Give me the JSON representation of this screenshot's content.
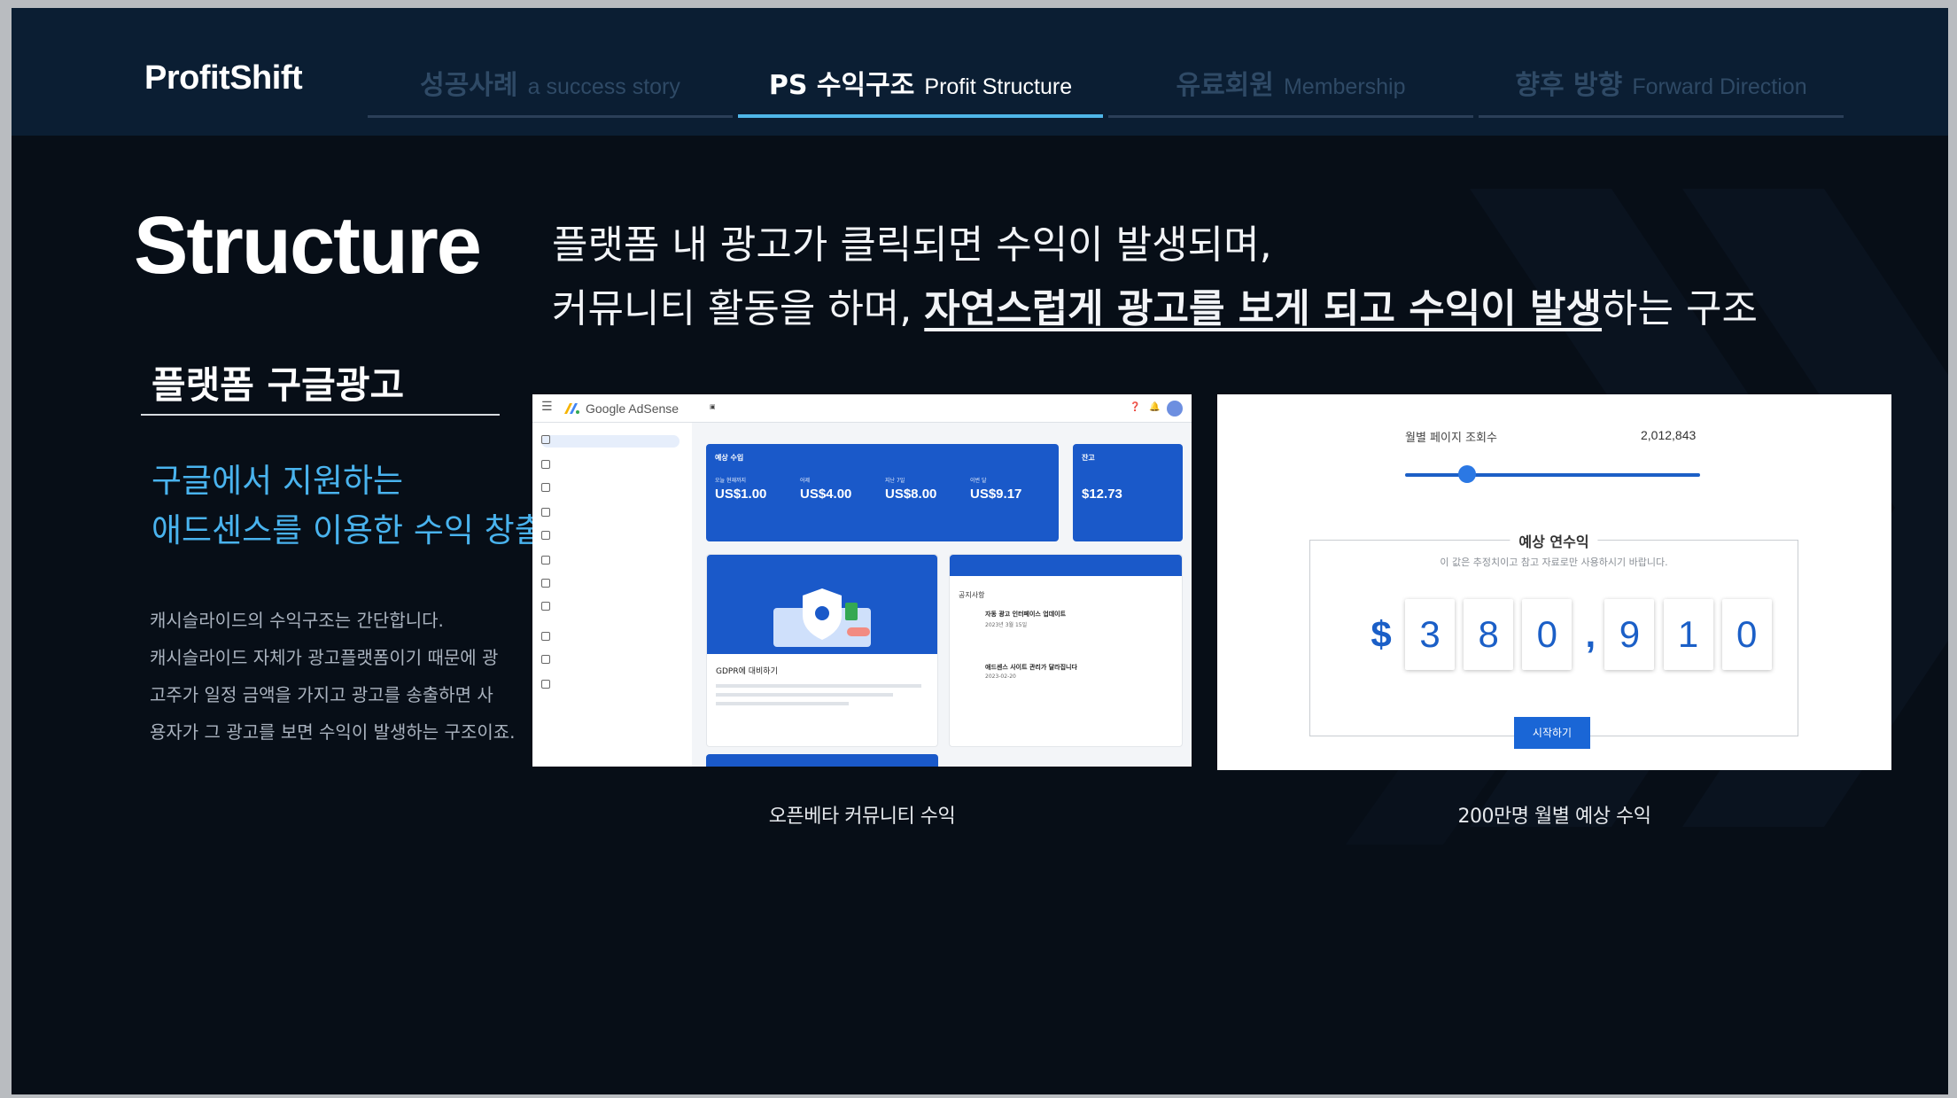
{
  "brand": "ProfitShift",
  "tabs": [
    {
      "ko": "성공사례",
      "en": "a success story",
      "active": false
    },
    {
      "ko": "PS 수익구조",
      "en": "Profit Structure",
      "active": true
    },
    {
      "ko": "유료회원",
      "en": "Membership",
      "active": false
    },
    {
      "ko": "향후 방향",
      "en": "Forward Direction",
      "active": false
    }
  ],
  "main": {
    "title": "Structure",
    "headline_line1": "플랫폼 내 광고가 클릭되면 수익이 발생되며,",
    "headline_line2_a": "커뮤니티 활동을 하며, ",
    "headline_line2_em": "자연스럽게 광고를 보게 되고 수익이 발생",
    "headline_line2_b": "하는 구조",
    "section_title": "플랫폼 구글광고",
    "blue_line1": "구글에서 지원하는",
    "blue_line2": "애드센스를 이용한 수익 창출",
    "desc_lines": [
      "캐시슬라이드의 수익구조는 간단합니다.",
      "캐시슬라이드 자체가 광고플랫폼이기 때문에 광",
      "고주가 일정 금액을 가지고 광고를 송출하면 사",
      "용자가 그 광고를 보면 수익이 발생하는 구조이죠."
    ]
  },
  "adsense": {
    "app_title": "Google AdSense",
    "card_title": "예상 수입",
    "metrics": [
      {
        "label": "오늘 현재까지",
        "value": "US$1.00"
      },
      {
        "label": "어제",
        "value": "US$4.00"
      },
      {
        "label": "지난 7일",
        "value": "US$8.00"
      },
      {
        "label": "이번 달",
        "value": "US$9.17"
      }
    ],
    "balance_label": "잔고",
    "balance_value": "$12.73",
    "promo_title": "GDPR에 대비하기",
    "notice_title": "공지사항",
    "notice_items": [
      "자동 광고 인터페이스 업데이트",
      "애드센스 사이트 관리가 달라집니다"
    ],
    "notice_dates": [
      "2023년 3월 15일",
      "2023-02-20"
    ]
  },
  "calculator": {
    "pageview_label": "월별 페이지 조회수",
    "pageview_value": "2,012,843",
    "slider_fraction": 0.21,
    "box_title": "예상 연수익",
    "box_note": "이 값은 추정치이고 참고 자료로만 사용하시기 바랍니다.",
    "currency": "$",
    "digits_a": [
      "3",
      "8",
      "0"
    ],
    "digits_b": [
      "9",
      "1",
      "0"
    ],
    "button": "시작하기"
  },
  "captions": {
    "left": "오픈베타 커뮤니티 수익",
    "right": "200만명 월별 예상 수익"
  },
  "colors": {
    "accent": "#4fb6e8",
    "blue_text": "#49b3ee",
    "bg": "#070e17",
    "header_bg": "#0b1e33"
  }
}
